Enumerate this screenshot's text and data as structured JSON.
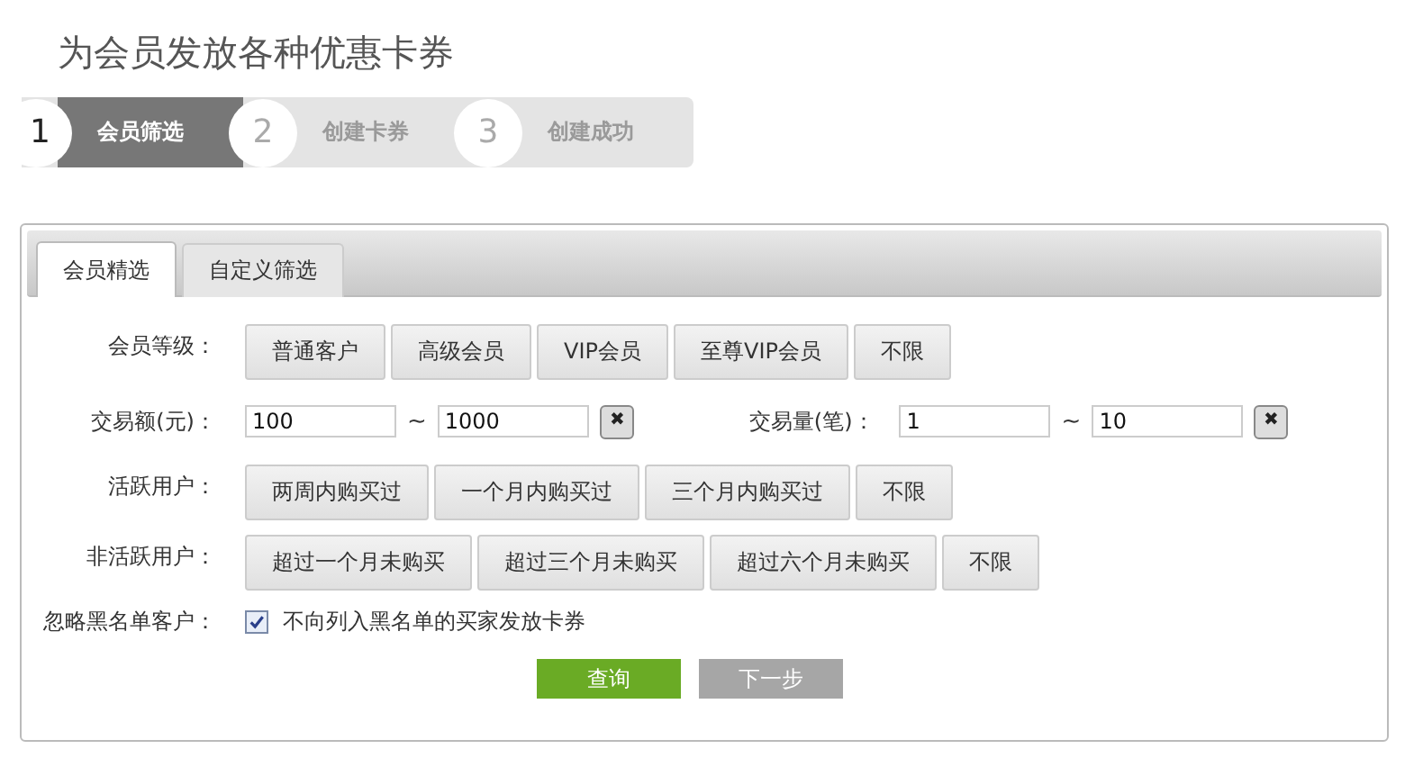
{
  "page_title": "为会员发放各种优惠卡券",
  "steps": [
    {
      "number": "1",
      "label": "会员筛选",
      "selected": true
    },
    {
      "number": "2",
      "label": "创建卡券",
      "selected": false
    },
    {
      "number": "3",
      "label": "创建成功",
      "selected": false
    }
  ],
  "tabs": [
    {
      "label": "会员精选",
      "selected": true
    },
    {
      "label": "自定义筛选",
      "selected": false
    }
  ],
  "rows": [
    {
      "kind": "options",
      "label": "会员等级：",
      "options": [
        {
          "label": "普通客户",
          "selected": false
        },
        {
          "label": "高级会员",
          "selected": false
        },
        {
          "label": "VIP会员",
          "selected": false
        },
        {
          "label": "至尊VIP会员",
          "selected": false
        },
        {
          "label": "不限",
          "selected": false
        }
      ]
    },
    {
      "kind": "ranges",
      "ranges": [
        {
          "label": "交易额(元)：",
          "from": "100",
          "separator": "~",
          "to": "1000",
          "clear": "✖"
        },
        {
          "label": "交易量(笔)：",
          "from": "1",
          "separator": "~",
          "to": "10",
          "clear": "✖"
        }
      ]
    },
    {
      "kind": "options",
      "label": "活跃用户：",
      "options": [
        {
          "label": "两周内购买过",
          "selected": false
        },
        {
          "label": "一个月内购买过",
          "selected": false
        },
        {
          "label": "三个月内购买过",
          "selected": false
        },
        {
          "label": "不限",
          "selected": false
        }
      ]
    },
    {
      "kind": "options",
      "label": "非活跃用户：",
      "options": [
        {
          "label": "超过一个月未购买",
          "selected": false
        },
        {
          "label": "超过三个月未购买",
          "selected": false
        },
        {
          "label": "超过六个月未购买",
          "selected": false
        },
        {
          "label": "不限",
          "selected": false
        }
      ]
    },
    {
      "kind": "checkbox",
      "label": "忽略黑名单客户：",
      "checked": true,
      "text": "不向列入黑名单的买家发放卡券"
    }
  ],
  "actions": [
    {
      "label": "查询",
      "kind": "primary"
    },
    {
      "label": "下一步",
      "kind": "secondary"
    }
  ]
}
